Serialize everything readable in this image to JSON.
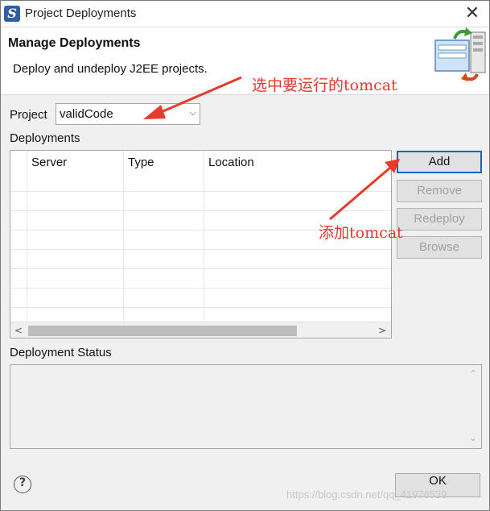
{
  "window": {
    "title": "Project Deployments",
    "close_glyph": "✕",
    "icon_letter": "S"
  },
  "header": {
    "title": "Manage Deployments",
    "description": "Deploy and undeploy J2EE projects."
  },
  "project": {
    "label": "Project",
    "value": "validCode"
  },
  "deployments": {
    "label": "Deployments",
    "columns": [
      "Server",
      "Type",
      "Location"
    ]
  },
  "buttons": {
    "add": "Add",
    "remove": "Remove",
    "redeploy": "Redeploy",
    "browse": "Browse"
  },
  "status": {
    "label": "Deployment Status"
  },
  "footer": {
    "help": "?",
    "ok": "OK"
  },
  "annotations": {
    "select_tomcat": "选中要运行的tomcat",
    "add_tomcat": "添加tomcat",
    "color": "#e53a2c"
  },
  "watermark": "https://blog.csdn.net/qq_41976539"
}
